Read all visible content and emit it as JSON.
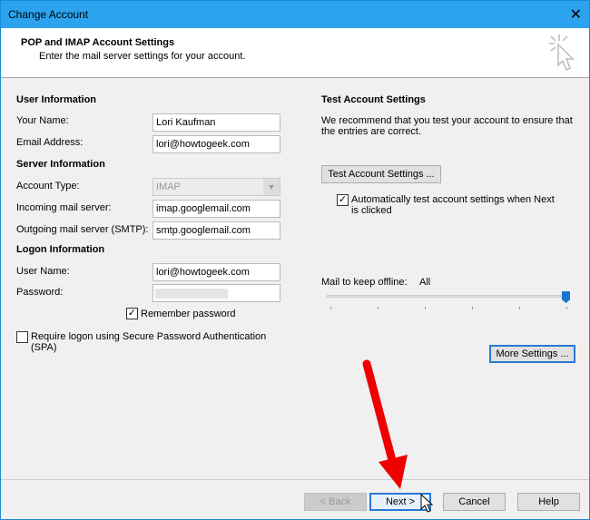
{
  "window": {
    "title": "Change Account",
    "close_icon": "close-icon"
  },
  "header": {
    "title": "POP and IMAP Account Settings",
    "subtitle": "Enter the mail server settings for your account."
  },
  "user_info": {
    "heading": "User Information",
    "name_label": "Your Name:",
    "name_value": "Lori Kaufman",
    "email_label": "Email Address:",
    "email_value": "lori@howtogeek.com"
  },
  "server_info": {
    "heading": "Server Information",
    "type_label": "Account Type:",
    "type_value": "IMAP",
    "incoming_label": "Incoming mail server:",
    "incoming_value": "imap.googlemail.com",
    "outgoing_label": "Outgoing mail server (SMTP):",
    "outgoing_value": "smtp.googlemail.com"
  },
  "logon_info": {
    "heading": "Logon Information",
    "user_label": "User Name:",
    "user_value": "lori@howtogeek.com",
    "password_label": "Password:",
    "remember_label": "Remember password",
    "remember_checked": true,
    "spa_label": "Require logon using Secure Password Authentication",
    "spa_label2": "(SPA)",
    "spa_checked": false
  },
  "test": {
    "heading": "Test Account Settings",
    "desc1": "We recommend that you test your account to ensure that",
    "desc2": "the entries are correct.",
    "button": "Test Account Settings ...",
    "auto_label1": "Automatically test account settings when Next",
    "auto_label2": "is clicked",
    "auto_checked": true
  },
  "offline": {
    "label": "Mail to keep offline:",
    "value": "All",
    "slider_fraction": 1.0
  },
  "more_settings": "More Settings ...",
  "footer": {
    "back": "< Back",
    "next": "Next >",
    "cancel": "Cancel",
    "help": "Help"
  },
  "colors": {
    "titlebar": "#2ba3ee",
    "accent": "#2a78d4",
    "arrow": "#e00000"
  }
}
